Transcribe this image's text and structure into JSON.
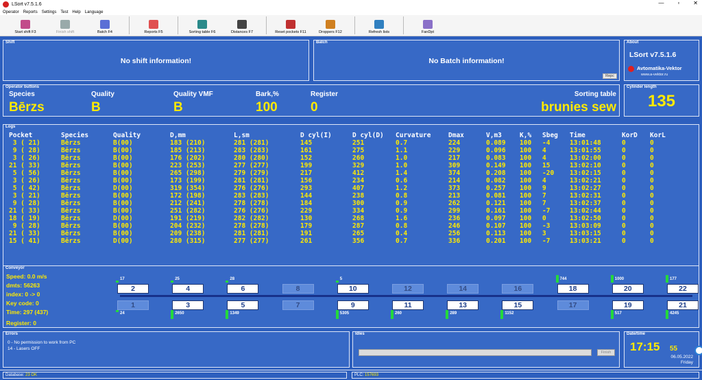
{
  "window": {
    "title": "LSort v7.5.1.6",
    "min": "—",
    "max": "▫",
    "close": "✕"
  },
  "menu": [
    "Operator",
    "Reports",
    "Settings",
    "Test",
    "Help",
    "Language"
  ],
  "toolbar": [
    {
      "label": "Start shift F3",
      "icon": "operators-icon",
      "color": "#c24b8a",
      "enabled": true
    },
    {
      "label": "Finish shift",
      "icon": "operators-icon",
      "color": "#9aa",
      "enabled": false
    },
    {
      "label": "Batch F4",
      "icon": "batch-icon",
      "color": "#5b6fd6",
      "enabled": true
    },
    {
      "label": "Reports F5",
      "icon": "report-icon",
      "color": "#e05050",
      "enabled": true
    },
    {
      "label": "Sorting table F6",
      "icon": "sorting-table-icon",
      "color": "#2a8a8a",
      "enabled": true
    },
    {
      "label": "Distances F7",
      "icon": "distances-icon",
      "color": "#444",
      "enabled": true
    },
    {
      "label": "Reset pockets F11",
      "icon": "reset-pockets-icon",
      "color": "#c03030",
      "enabled": true
    },
    {
      "label": "Droppers F12",
      "icon": "droppers-icon",
      "color": "#d08020",
      "enabled": true
    },
    {
      "label": "Refresh lists",
      "icon": "refresh-icon",
      "color": "#3080c0",
      "enabled": true
    },
    {
      "label": "FanDpt",
      "icon": "fan-icon",
      "color": "#8a70c8",
      "enabled": true
    }
  ],
  "shift": {
    "title": "Shift",
    "message": "No shift information!"
  },
  "batch": {
    "title": "Batch",
    "message": "No Batch information!",
    "button": "Repc"
  },
  "about": {
    "title": "About",
    "name": "LSort v7.5.1.6",
    "company": "Avtomatika-Vektor",
    "site": "www.a-vektor.ru"
  },
  "operator": {
    "title": "Operator buttons",
    "species_label": "Species",
    "species": "Bērzs",
    "quality_label": "Quality",
    "quality": "B",
    "quality_vmf_label": "Quality VMF",
    "quality_vmf": "B",
    "bark_label": "Bark,%",
    "bark": "100",
    "register_label": "Register",
    "register": "0",
    "sorting_table_label": "Sorting table",
    "sorting_table": "brunies sew"
  },
  "cylinder": {
    "title": "Cylinder length",
    "value": "135"
  },
  "logs": {
    "title": "Logs",
    "columns": [
      "Pocket",
      "Species",
      "Quality",
      "D,mm",
      "L,sm",
      "D cyl(I)",
      "D cyl(D)",
      "Curvature",
      "Dmax",
      "V,m3",
      "K,%",
      "Sbeg",
      "Time",
      "KorD",
      "KorL"
    ],
    "rows": [
      [
        " 3 ( 21)",
        "Bērzs",
        "B(00)",
        "183 (210)",
        "281 (281)",
        "145",
        "251",
        "0.7",
        "224",
        "0.089",
        "100",
        "-4",
        "13:01:48",
        "0",
        "0"
      ],
      [
        " 9 ( 28)",
        "Bērzs",
        "B(00)",
        "185 (213)",
        "283 (283)",
        "161",
        "275",
        "1.1",
        "229",
        "0.096",
        "100",
        "4",
        "13:01:55",
        "0",
        "0"
      ],
      [
        " 3 ( 26)",
        "Bērzs",
        "B(00)",
        "176 (202)",
        "280 (280)",
        "152",
        "260",
        "1.0",
        "217",
        "0.083",
        "100",
        "4",
        "13:02:00",
        "0",
        "0"
      ],
      [
        "21 ( 33)",
        "Bērzs",
        "B(00)",
        "223 (253)",
        "277 (277)",
        "199",
        "329",
        "1.0",
        "309",
        "0.149",
        "100",
        "15",
        "13:02:10",
        "0",
        "0"
      ],
      [
        " 5 ( 56)",
        "Bērzs",
        "B(00)",
        "265 (298)",
        "279 (279)",
        "217",
        "412",
        "1.4",
        "374",
        "0.208",
        "100",
        "-20",
        "13:02:15",
        "0",
        "0"
      ],
      [
        " 3 ( 26)",
        "Bērzs",
        "B(00)",
        "173 (199)",
        "281 (281)",
        "156",
        "234",
        "0.6",
        "214",
        "0.082",
        "100",
        "4",
        "13:02:21",
        "0",
        "0"
      ],
      [
        " 5 ( 42)",
        "Bērzs",
        "D(00)",
        "319 (354)",
        "276 (276)",
        "293",
        "407",
        "1.2",
        "373",
        "0.257",
        "100",
        "9",
        "13:02:27",
        "0",
        "0"
      ],
      [
        " 3 ( 21)",
        "Bērzs",
        "B(00)",
        "172 (198)",
        "283 (283)",
        "144",
        "238",
        "0.8",
        "213",
        "0.081",
        "100",
        "7",
        "13:02:31",
        "0",
        "0"
      ],
      [
        " 9 ( 28)",
        "Bērzs",
        "B(00)",
        "212 (241)",
        "278 (278)",
        "184",
        "300",
        "0.9",
        "262",
        "0.121",
        "100",
        "7",
        "13:02:37",
        "0",
        "0"
      ],
      [
        "21 ( 33)",
        "Bērzs",
        "B(00)",
        "251 (282)",
        "276 (276)",
        "229",
        "334",
        "0.9",
        "299",
        "0.161",
        "100",
        "-7",
        "13:02:44",
        "0",
        "0"
      ],
      [
        "18 ( 19)",
        "Bērzs",
        "D(00)",
        "191 (219)",
        "282 (282)",
        "130",
        "268",
        "1.6",
        "236",
        "0.097",
        "100",
        "0",
        "13:02:50",
        "0",
        "0"
      ],
      [
        " 9 ( 28)",
        "Bērzs",
        "B(00)",
        "204 (232)",
        "278 (278)",
        "179",
        "287",
        "0.8",
        "246",
        "0.107",
        "100",
        "-3",
        "13:03:09",
        "0",
        "0"
      ],
      [
        "21 ( 33)",
        "Bērzs",
        "B(00)",
        "209 (238)",
        "281 (281)",
        "191",
        "265",
        "0.4",
        "256",
        "0.113",
        "100",
        "3",
        "13:03:15",
        "0",
        "0"
      ],
      [
        "15 ( 41)",
        "Bērzs",
        "D(00)",
        "280 (315)",
        "277 (277)",
        "261",
        "356",
        "0.7",
        "336",
        "0.201",
        "100",
        "-7",
        "13:03:21",
        "0",
        "0"
      ]
    ]
  },
  "conveyor": {
    "title": "Conveyor",
    "speed": "Speed: 0.0 m/s",
    "dmts": "dmts: 56263",
    "index": "index: 0 -> 0",
    "key_code": "Key code:  0",
    "time": "Time: 297 (437)",
    "register": "Register: 0",
    "top_pockets": [
      {
        "num": "2",
        "state": "active",
        "count": "17",
        "level": 0.1
      },
      {
        "num": "4",
        "state": "active",
        "count": "25",
        "level": 0.1
      },
      {
        "num": "6",
        "state": "active",
        "count": "28",
        "level": 0.1
      },
      {
        "num": "8",
        "state": "dim",
        "count": "",
        "level": 0
      },
      {
        "num": "10",
        "state": "active",
        "count": "5",
        "level": 0.05
      },
      {
        "num": "12",
        "state": "dim",
        "count": "",
        "level": 0
      },
      {
        "num": "14",
        "state": "dim",
        "count": "",
        "level": 0
      },
      {
        "num": "16",
        "state": "dim",
        "count": "",
        "level": 0
      },
      {
        "num": "18",
        "state": "active",
        "count": "744",
        "level": 0.8
      },
      {
        "num": "20",
        "state": "active",
        "count": "1000",
        "level": 0.8
      },
      {
        "num": "22",
        "state": "active",
        "count": "177",
        "level": 0.8
      }
    ],
    "bottom_pockets": [
      {
        "num": "1",
        "state": "dim",
        "count": "24",
        "level": 0.2
      },
      {
        "num": "3",
        "state": "active",
        "count": "2650",
        "level": 0.9
      },
      {
        "num": "5",
        "state": "active",
        "count": "1349",
        "level": 0.9
      },
      {
        "num": "7",
        "state": "dim",
        "count": "",
        "level": 0
      },
      {
        "num": "9",
        "state": "active",
        "count": "5305",
        "level": 0.9
      },
      {
        "num": "11",
        "state": "active",
        "count": "260",
        "level": 0.9
      },
      {
        "num": "13",
        "state": "active",
        "count": "289",
        "level": 0.9
      },
      {
        "num": "15",
        "state": "active",
        "count": "1152",
        "level": 0.9
      },
      {
        "num": "17",
        "state": "dim",
        "count": "",
        "level": 0
      },
      {
        "num": "19",
        "state": "active",
        "count": "517",
        "level": 0.9
      },
      {
        "num": "21",
        "state": "active",
        "count": "4245",
        "level": 0.9
      }
    ]
  },
  "errors": {
    "title": "Errors",
    "lines": [
      "0 - No permission to work from PC",
      "14 - Lasers OFF"
    ]
  },
  "idles": {
    "title": "Idles",
    "finish": "Finish"
  },
  "datetime": {
    "title": "Date/time",
    "hm": "17:15",
    "sec": "55",
    "date": "06.05.2022",
    "day": "Friday"
  },
  "status": {
    "db_label": "Database:",
    "db_value": "23 OK",
    "plc_label": "PLC:",
    "plc_value": "157693"
  }
}
